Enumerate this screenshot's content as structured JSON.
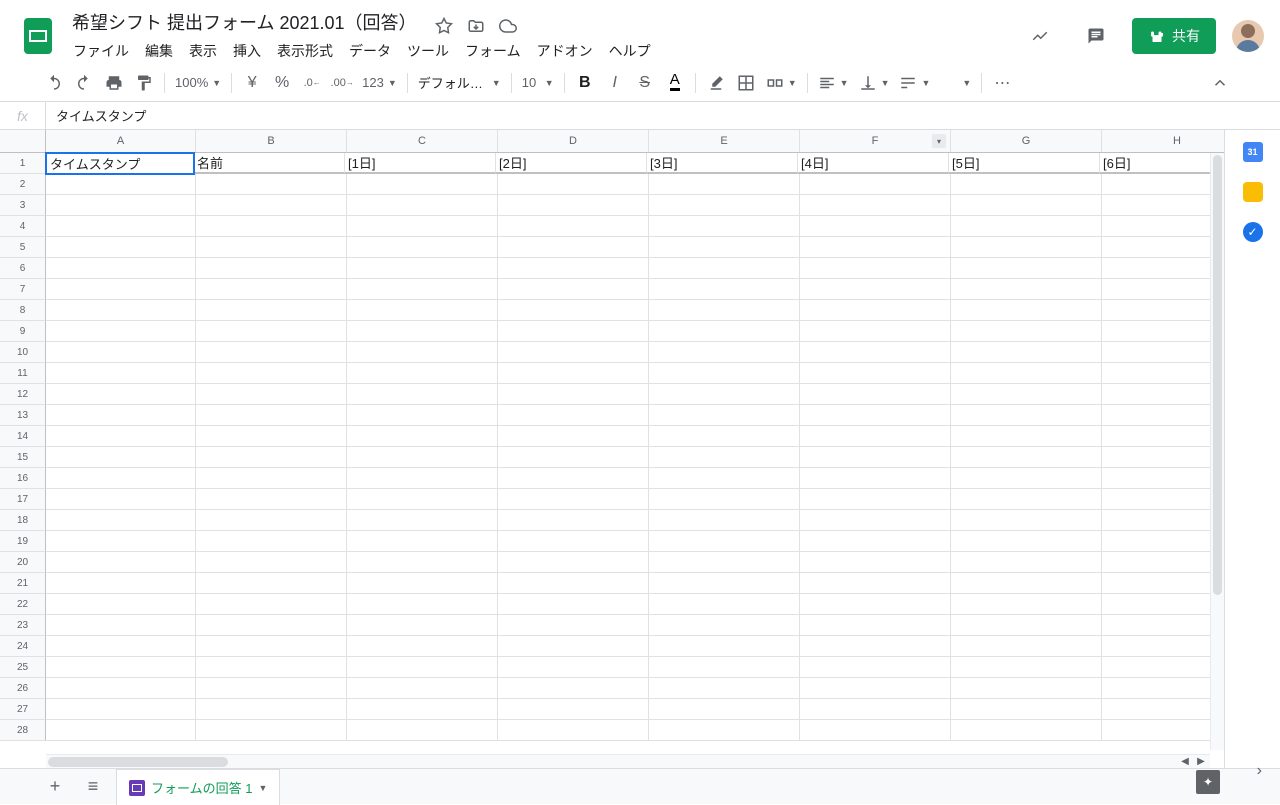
{
  "doc_title": "希望シフト 提出フォーム 2021.01（回答）",
  "menu": [
    "ファイル",
    "編集",
    "表示",
    "挿入",
    "表示形式",
    "データ",
    "ツール",
    "フォーム",
    "アドオン",
    "ヘルプ"
  ],
  "toolbar": {
    "zoom": "100%",
    "currency": "¥",
    "percent": "%",
    "dec_dec": ".0",
    "inc_dec": ".00",
    "more_fmt": "123",
    "font": "デフォルト...",
    "font_size": "10",
    "bold": "B",
    "italic": "I",
    "strike": "S",
    "text_color": "A"
  },
  "share_label": "共有",
  "formula_value": "タイムスタンプ",
  "columns": [
    "A",
    "B",
    "C",
    "D",
    "E",
    "F",
    "G",
    "H"
  ],
  "filter_col_index": 5,
  "row_count": 28,
  "row1_cells": [
    "タイムスタンプ",
    "名前",
    "[1日]",
    "[2日]",
    "[3日]",
    "[4日]",
    "[5日]",
    "[6日]"
  ],
  "sheet_tab": "フォームの回答 1",
  "side": {
    "cal": "31"
  }
}
